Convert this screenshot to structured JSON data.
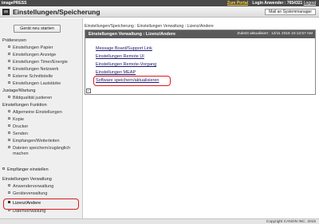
{
  "top_bar": {
    "brand": "imagePRESS",
    "portal": "Zum Portal",
    "login": "Login Anwender : 7654321",
    "logout": "Logout"
  },
  "title_bar": {
    "title": "Einstellungen/Speicherung",
    "mail_button": "Mail an Systemmanager"
  },
  "sidebar": {
    "start_button": "Gerät neu starten",
    "sections": {
      "preferences": "Präferenzen",
      "adjustment": "Justage/Wartung",
      "function_settings": "Einstellungen Funktion",
      "recipient": "Empfänger einstellen",
      "management": "Einstellungen Verwaltung"
    },
    "preferences_items": [
      "Einstellungen Papier",
      "Einstellungen Anzeige",
      "Einstellungen Timer/Energie",
      "Einstellungen Netzwerk",
      "Externe Schnittstelle",
      "Einstellungen Lautstärke"
    ],
    "adjustment_items": [
      "Bildqualität justieren"
    ],
    "function_items": [
      "Allgemeine Einstellungen",
      "Kopie",
      "Drucker",
      "Senden",
      "Empfangen/Weiterleiten",
      "Dateien speichern/zugänglich",
      "machen"
    ],
    "management_items": [
      "Anwenderverwaltung",
      "Geräteverwaltung",
      "Lizenz/Andere",
      "Datenverwaltung"
    ]
  },
  "main": {
    "breadcrumb": "Einstellungen/Speicherung : Einstellungen Verwaltung : Lizenz/Andere",
    "panel_title": "Einstellungen Verwaltung : Lizenz/Andere",
    "updated": "Zuletzt aktualisiert : 12/11 2015 10:13:57 AM",
    "links": [
      "Message Board/Support Link",
      "Einstellungen Remote UI",
      "Einstellungen Remote-Vorgang",
      "Einstellungen MEAP",
      "Software speichern/aktualisieren"
    ]
  },
  "footer": {
    "copyright": "Copyright CANON INC. 2015"
  },
  "colors": {
    "highlight_box": "#d81b22",
    "header_dark": "#4a4a4a",
    "portal_accent": "#ffd23a",
    "link": "#1a1a6e"
  }
}
